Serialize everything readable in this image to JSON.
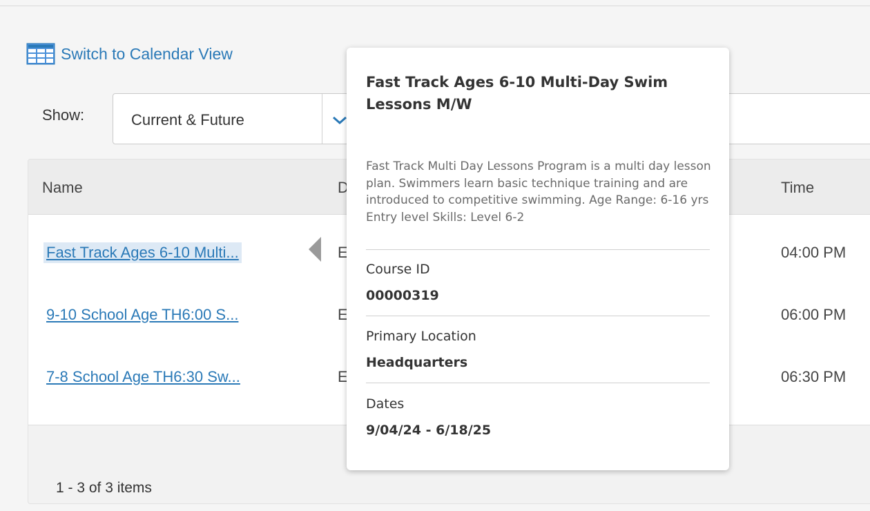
{
  "toolbar": {
    "switch_view_label": "Switch to Calendar View",
    "show_label": "Show:",
    "show_value": "Current & Future"
  },
  "grid": {
    "columns": {
      "name": "Name",
      "d": "D",
      "time": "Time"
    },
    "rows": [
      {
        "name": "Fast Track Ages 6-10 Multi...",
        "d": "E",
        "time": "04:00 PM"
      },
      {
        "name": "9-10 School Age TH6:00 S...",
        "d": "E",
        "time": "06:00 PM"
      },
      {
        "name": "7-8 School Age TH6:30 Sw...",
        "d": "E",
        "time": "06:30 PM"
      }
    ],
    "pager": "1 - 3 of 3 items"
  },
  "tooltip": {
    "title": "Fast Track Ages 6-10 Multi-Day Swim Lessons M/W",
    "description": "Fast Track Multi Day Lessons Program is a multi day lesson plan. Swimmers learn basic technique training and are introduced to competitive swimming. Age Range: 6-16 yrs Entry level Skills: Level 6-2",
    "fields": [
      {
        "label": "Course ID",
        "value": "00000319"
      },
      {
        "label": "Primary Location",
        "value": "Headquarters"
      },
      {
        "label": "Dates",
        "value": "9/04/24 - 6/18/25"
      }
    ]
  },
  "colors": {
    "link": "#2a79b7",
    "hover_row": "#dde9f5"
  }
}
